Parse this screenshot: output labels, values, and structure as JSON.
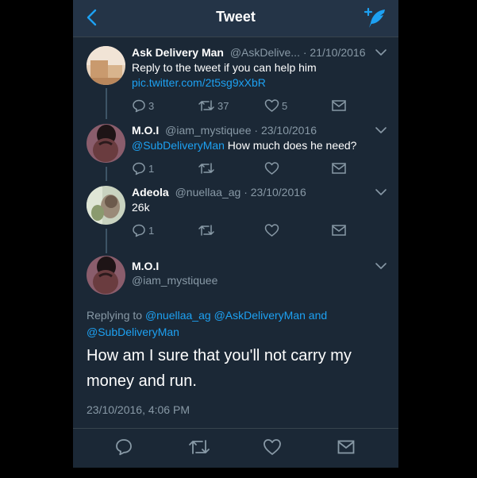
{
  "nav": {
    "title": "Tweet"
  },
  "thread": [
    {
      "name": "Ask Delivery Man",
      "handle": "@AskDelive...",
      "date": "· 21/10/2016",
      "text": "Reply to the tweet if you can help him",
      "link": "pic.twitter.com/2t5sg9xXbR",
      "replies": "3",
      "retweets": "37",
      "likes": "5"
    },
    {
      "name": "M.O.I",
      "handle": "@iam_mystiquee",
      "date": "· 23/10/2016",
      "mention": "@SubDeliveryMan",
      "text": " How much does he need?",
      "replies": "1",
      "retweets": "",
      "likes": ""
    },
    {
      "name": "Adeola",
      "handle": "@nuellaa_ag",
      "date": "· 23/10/2016",
      "text": "26k",
      "replies": "1",
      "retweets": "",
      "likes": ""
    }
  ],
  "main": {
    "name": "M.O.I",
    "handle": "@iam_mystiquee",
    "replying_prefix": "Replying to ",
    "replying_to": [
      "@nuellaa_ag",
      "@AskDeliveryMan"
    ],
    "replying_and": " and",
    "replying_last": "@SubDeliveryMan",
    "text": "How am I sure that you'll not carry my money and run.",
    "timestamp": "23/10/2016, 4:06 PM"
  },
  "colors": {
    "background": "#1b2836",
    "nav": "#243447",
    "accent": "#1da1f2",
    "muted": "#8899a6"
  }
}
